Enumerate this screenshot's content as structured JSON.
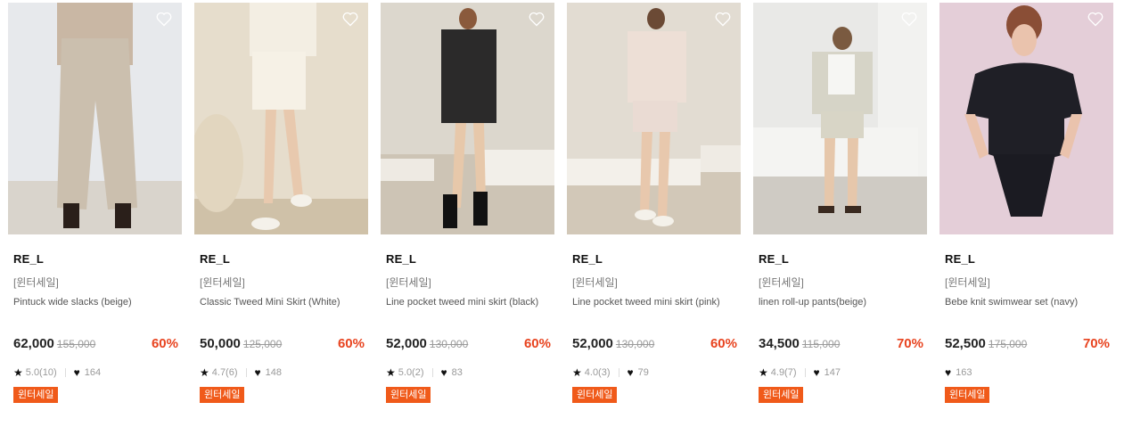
{
  "products": [
    {
      "brand": "RE_L",
      "event": "[윈터세일]",
      "name": "Pintuck wide slacks (beige)",
      "price": "62,000",
      "original_price": "155,000",
      "discount": "60%",
      "rating": "5.0(10)",
      "likes": "164",
      "badge": "윈터세일",
      "image": "model-beige-wide-slacks-photo"
    },
    {
      "brand": "RE_L",
      "event": "[윈터세일]",
      "name": "Classic Tweed Mini Skirt (White)",
      "price": "50,000",
      "original_price": "125,000",
      "discount": "60%",
      "rating": "4.7(6)",
      "likes": "148",
      "badge": "윈터세일",
      "image": "model-white-tweed-skirt-photo"
    },
    {
      "brand": "RE_L",
      "event": "[윈터세일]",
      "name": "Line pocket tweed mini skirt (black)",
      "price": "52,000",
      "original_price": "130,000",
      "discount": "60%",
      "rating": "5.0(2)",
      "likes": "83",
      "badge": "윈터세일",
      "image": "model-black-tweed-set-photo"
    },
    {
      "brand": "RE_L",
      "event": "[윈터세일]",
      "name": "Line pocket tweed mini skirt (pink)",
      "price": "52,000",
      "original_price": "130,000",
      "discount": "60%",
      "rating": "4.0(3)",
      "likes": "79",
      "badge": "윈터세일",
      "image": "model-pink-tweed-set-photo"
    },
    {
      "brand": "RE_L",
      "event": "[윈터세일]",
      "name": "linen roll-up pants(beige)",
      "price": "34,500",
      "original_price": "115,000",
      "discount": "70%",
      "rating": "4.9(7)",
      "likes": "147",
      "badge": "윈터세일",
      "image": "model-linen-shorts-photo"
    },
    {
      "brand": "RE_L",
      "event": "[윈터세일]",
      "name": "Bebe knit swimwear set (navy)",
      "price": "52,500",
      "original_price": "175,000",
      "discount": "70%",
      "rating": "",
      "likes": "163",
      "badge": "윈터세일",
      "image": "model-navy-swimwear-photo"
    }
  ],
  "icons": {
    "wishlist": "heart-outline-icon",
    "rating": "star-icon",
    "likes": "heart-filled-icon"
  },
  "colors": {
    "discount": "#e8431f",
    "badge_bg": "#f05a1a",
    "text": "#222222",
    "muted": "#999999"
  }
}
